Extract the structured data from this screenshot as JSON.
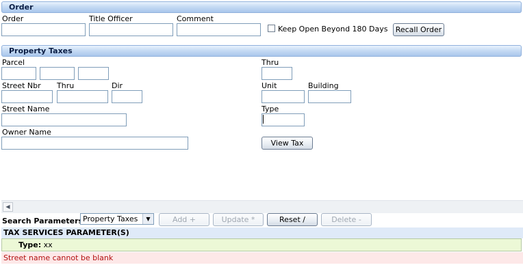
{
  "order": {
    "header": "Order",
    "order_label": "Order",
    "title_officer_label": "Title Officer",
    "comment_label": "Comment",
    "keep_open_label": "Keep Open Beyond 180 Days",
    "recall_order_button": "Recall Order"
  },
  "property_taxes": {
    "header": "Property Taxes",
    "parcel_label": "Parcel",
    "thru_label": "Thru",
    "street_nbr_label": "Street Nbr",
    "street_thru_label": "Thru",
    "dir_label": "Dir",
    "unit_label": "Unit",
    "building_label": "Building",
    "street_name_label": "Street Name",
    "type_label": "Type",
    "owner_name_label": "Owner Name",
    "view_tax_button": "View Tax"
  },
  "search": {
    "label": "Search Parameters",
    "selected_option": "Property Taxes",
    "add_button": "Add +",
    "update_button": "Update *",
    "reset_button": "Reset /",
    "delete_button": "Delete -"
  },
  "tax_services": {
    "header": "TAX SERVICES PARAMETER(S)",
    "type_label": "Type:",
    "type_value": "xx"
  },
  "error_message": "Street name cannot be blank"
}
